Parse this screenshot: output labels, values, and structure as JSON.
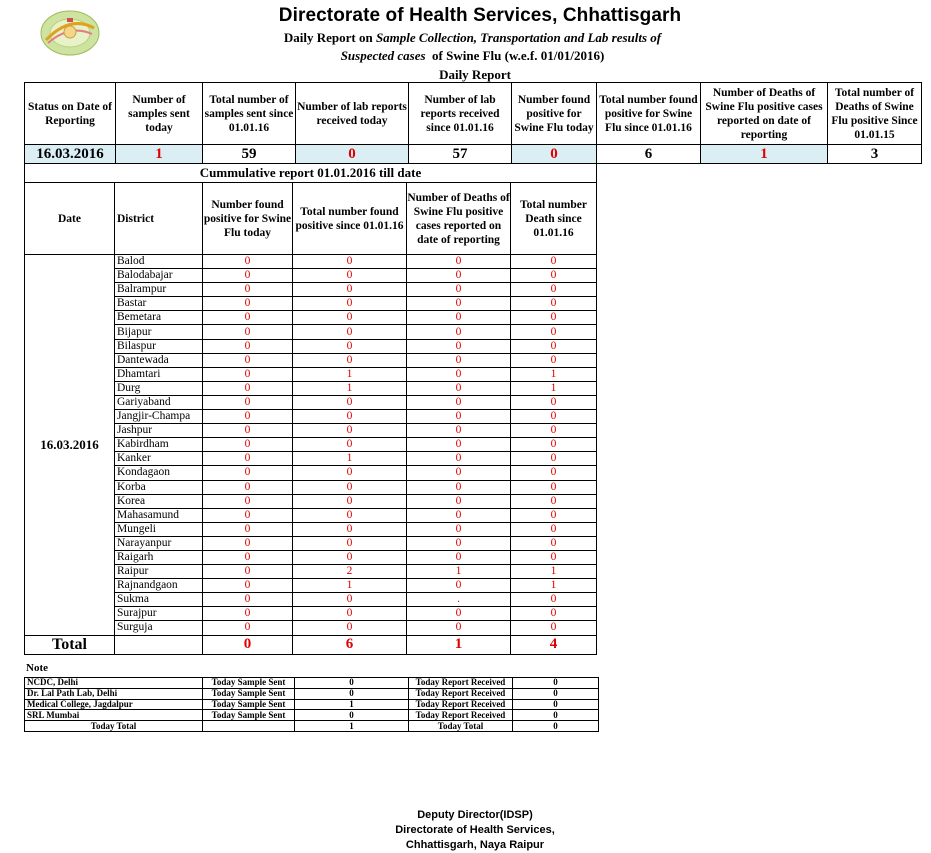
{
  "header": {
    "title": "Directorate of Health Services, Chhattisgarh",
    "subtitle_prefix": "Daily Report on",
    "subtitle_italic_1": "Sample Collection, Transportation and Lab results of",
    "subtitle_italic_2": "Suspected cases",
    "subtitle_suffix": "of Swine Flu (w.e.f.  01/01/2016)",
    "daily_heading": "Daily Report"
  },
  "daily": {
    "headers": [
      "Status on Date of Reporting",
      "Number of samples sent today",
      "Total number of samples sent since 01.01.16",
      "Number of lab reports received today",
      "Number of lab reports received since 01.01.16",
      "Number found positive for Swine Flu today",
      "Total number found positive for Swine Flu since 01.01.16",
      "Number of Deaths of Swine Flu positive cases reported on date of reporting",
      "Total number of Deaths of Swine Flu positive Since 01.01.15"
    ],
    "values": [
      "16.03.2016",
      "1",
      "59",
      "0",
      "57",
      "0",
      "6",
      "1",
      "3"
    ]
  },
  "cumulative": {
    "caption": "Cummulative report 01.01.2016 till date",
    "headers": [
      "Date",
      "District",
      "Number found positive for Swine Flu today",
      "Total number found positive since 01.01.16",
      "Number of Deaths of Swine Flu positive cases reported on date of reporting",
      "Total number Death since 01.01.16"
    ],
    "date": "16.03.2016",
    "rows": [
      {
        "district": "Balod",
        "v": [
          "0",
          "0",
          "0",
          "0"
        ]
      },
      {
        "district": "Balodabajar",
        "v": [
          "0",
          "0",
          "0",
          "0"
        ]
      },
      {
        "district": "Balrampur",
        "v": [
          "0",
          "0",
          "0",
          "0"
        ]
      },
      {
        "district": "Bastar",
        "v": [
          "0",
          "0",
          "0",
          "0"
        ]
      },
      {
        "district": "Bemetara",
        "v": [
          "0",
          "0",
          "0",
          "0"
        ]
      },
      {
        "district": "Bijapur",
        "v": [
          "0",
          "0",
          "0",
          "0"
        ]
      },
      {
        "district": "Bilaspur",
        "v": [
          "0",
          "0",
          "0",
          "0"
        ]
      },
      {
        "district": "Dantewada",
        "v": [
          "0",
          "0",
          "0",
          "0"
        ]
      },
      {
        "district": "Dhamtari",
        "v": [
          "0",
          "1",
          "0",
          "1"
        ]
      },
      {
        "district": "Durg",
        "v": [
          "0",
          "1",
          "0",
          "1"
        ]
      },
      {
        "district": "Gariyaband",
        "v": [
          "0",
          "0",
          "0",
          "0"
        ]
      },
      {
        "district": "Jangjir-Champa",
        "v": [
          "0",
          "0",
          "0",
          "0"
        ]
      },
      {
        "district": "Jashpur",
        "v": [
          "0",
          "0",
          "0",
          "0"
        ]
      },
      {
        "district": "Kabirdham",
        "v": [
          "0",
          "0",
          "0",
          "0"
        ]
      },
      {
        "district": "Kanker",
        "v": [
          "0",
          "1",
          "0",
          "0"
        ]
      },
      {
        "district": "Kondagaon",
        "v": [
          "0",
          "0",
          "0",
          "0"
        ]
      },
      {
        "district": "Korba",
        "v": [
          "0",
          "0",
          "0",
          "0"
        ]
      },
      {
        "district": "Korea",
        "v": [
          "0",
          "0",
          "0",
          "0"
        ]
      },
      {
        "district": "Mahasamund",
        "v": [
          "0",
          "0",
          "0",
          "0"
        ]
      },
      {
        "district": "Mungeli",
        "v": [
          "0",
          "0",
          "0",
          "0"
        ]
      },
      {
        "district": "Narayanpur",
        "v": [
          "0",
          "0",
          "0",
          "0"
        ]
      },
      {
        "district": "Raigarh",
        "v": [
          "0",
          "0",
          "0",
          "0"
        ]
      },
      {
        "district": "Raipur",
        "v": [
          "0",
          "2",
          "1",
          "1"
        ]
      },
      {
        "district": "Rajnandgaon",
        "v": [
          "0",
          "1",
          "0",
          "1"
        ]
      },
      {
        "district": "Sukma",
        "v": [
          "0",
          "0",
          ".",
          "0"
        ]
      },
      {
        "district": "Surajpur",
        "v": [
          "0",
          "0",
          "0",
          "0"
        ]
      },
      {
        "district": "Surguja",
        "v": [
          "0",
          "0",
          "0",
          "0"
        ]
      }
    ],
    "total_label": "Total",
    "totals": [
      "0",
      "6",
      "1",
      "4"
    ]
  },
  "note": {
    "label": "Note",
    "rows": [
      {
        "lab": "NCDC,  Delhi",
        "sent_label": "Today Sample Sent",
        "sent": "0",
        "recv_label": "Today Report Received",
        "recv": "0"
      },
      {
        "lab": "Dr. Lal Path Lab, Delhi",
        "sent_label": "Today Sample Sent",
        "sent": "0",
        "recv_label": "Today Report Received",
        "recv": "0"
      },
      {
        "lab": "Medical College, Jagdalpur",
        "sent_label": "Today Sample Sent",
        "sent": "1",
        "recv_label": "Today Report Received",
        "recv": "0"
      },
      {
        "lab": "SRL Mumbai",
        "sent_label": "Today Sample Sent",
        "sent": "0",
        "recv_label": "Today Report Received",
        "recv": "0"
      }
    ],
    "total_row": {
      "label": "Today Total",
      "sent": "1",
      "recv_label": "Today Total",
      "recv": "0"
    }
  },
  "footer": {
    "line1": "Deputy Director(IDSP)",
    "line2": "Directorate of Health   Services,",
    "line3": "Chhattisgarh, Naya Raipur"
  },
  "colors": {
    "highlight": "#daeef3",
    "red_value": "#e00000"
  },
  "logo_icon": "health-dept-logo-icon"
}
